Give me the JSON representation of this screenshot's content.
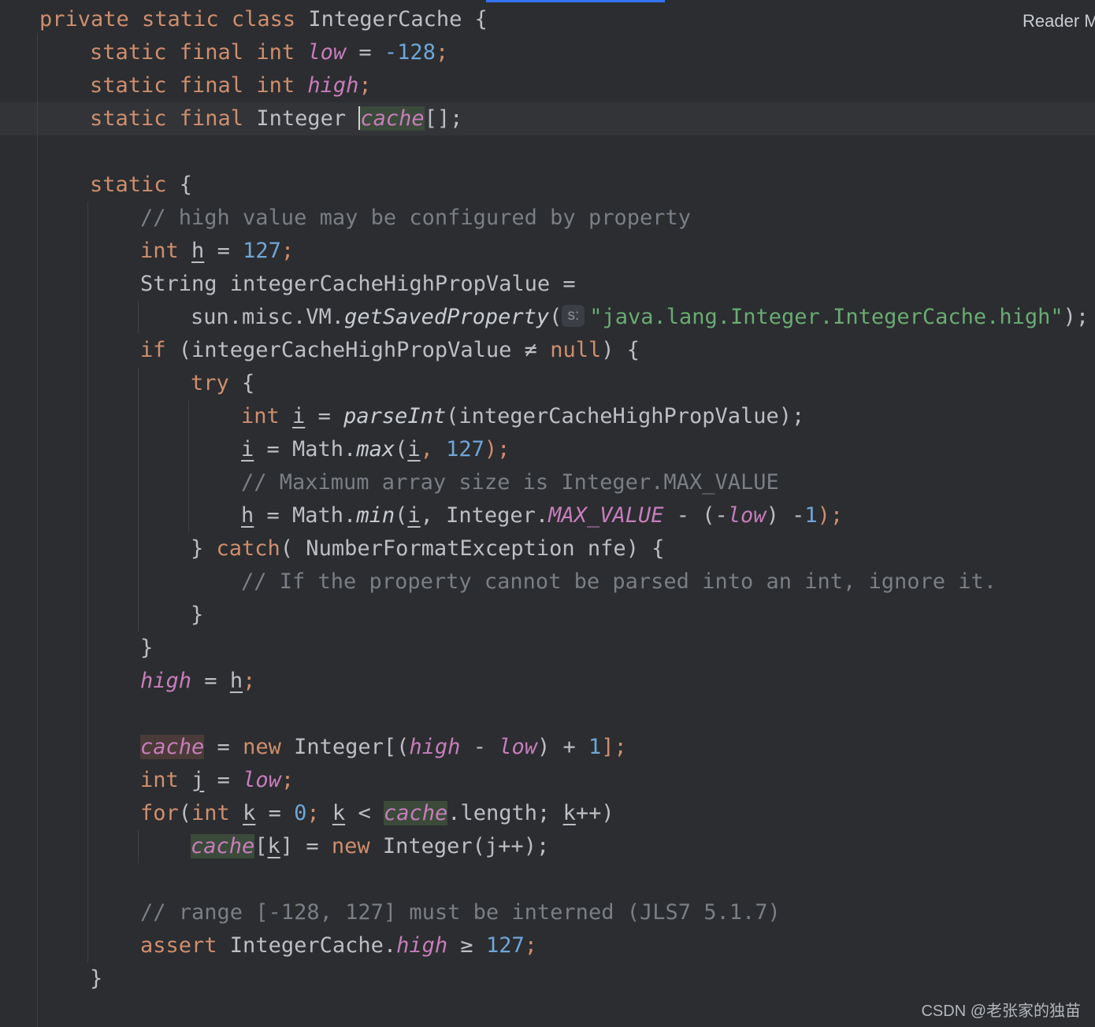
{
  "header": {
    "reader_mode": "Reader M"
  },
  "watermark": "CSDN @老张家的独苗",
  "code": {
    "l1": [
      "private static class",
      " IntegerCache {"
    ],
    "l2": [
      "static final int",
      "low",
      " = ",
      "-128",
      ";"
    ],
    "l3": [
      "static final int",
      "high",
      ";"
    ],
    "l4": [
      "static final",
      " Integer ",
      "cache",
      "[];"
    ],
    "l6": [
      "static",
      " {"
    ],
    "l7": "// high value may be configured by property",
    "l8": [
      "int",
      "h",
      " = ",
      "127",
      ";"
    ],
    "l9": [
      "String integerCacheHighPropValue ="
    ],
    "l10": [
      "sun.misc.VM.",
      "getSavedProperty",
      "(",
      "s:",
      "\"java.lang.Integer.IntegerCache.high\"",
      ");"
    ],
    "l11": [
      "if",
      " (integerCacheHighPropValue ≠ ",
      "null",
      ") {"
    ],
    "l12": [
      "try",
      " {"
    ],
    "l13": [
      "int",
      "i",
      " = ",
      "parseInt",
      "(integerCacheHighPropValue);"
    ],
    "l14": [
      "i",
      " = Math.",
      "max",
      "(",
      "i",
      ", ",
      "127",
      ");"
    ],
    "l15": "// Maximum array size is Integer.MAX_VALUE",
    "l16": [
      "h",
      " = Math.",
      "min",
      "(",
      "i",
      ", Integer.",
      "MAX_VALUE",
      " - (-",
      "low",
      ") -",
      "1",
      ");"
    ],
    "l17": [
      "} ",
      "catch",
      "( NumberFormatException nfe) {"
    ],
    "l18": "// If the property cannot be parsed into an int, ignore it.",
    "l19": "}",
    "l20": "}",
    "l21": [
      "high",
      " = ",
      "h",
      ";"
    ],
    "l23": [
      "cache",
      " = ",
      "new",
      " Integer[(",
      "high",
      " - ",
      "low",
      ") + ",
      "1",
      "];"
    ],
    "l24": [
      "int",
      "j",
      " = ",
      "low",
      ";"
    ],
    "l25": [
      "for",
      "(",
      "int",
      "k",
      " = ",
      "0",
      "; ",
      "k",
      " < ",
      "cache",
      ".length; ",
      "k",
      "++)"
    ],
    "l26": [
      "cache",
      "[",
      "k",
      "] = ",
      "new",
      " Integer(j++);"
    ],
    "l28": "// range [-128, 127] must be interned (JLS7 5.1.7)",
    "l29": [
      "assert",
      " IntegerCache.",
      "high",
      " ≥ ",
      "127",
      ";"
    ],
    "l30": "}"
  },
  "colors": {
    "background": "#2b2d30",
    "keyword": "#cf8e6d",
    "number": "#6fa6d8",
    "string": "#6aab73",
    "comment": "#7a7e85",
    "field": "#c77dbb",
    "text": "#bcbec4"
  }
}
